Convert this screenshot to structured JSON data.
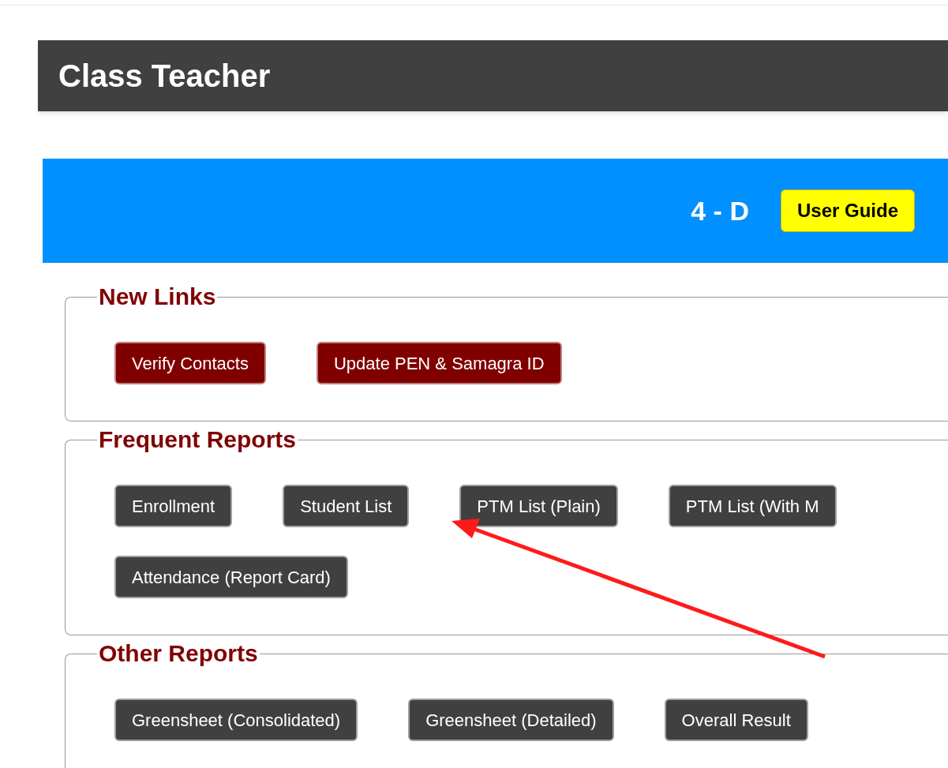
{
  "header": {
    "title": "Class Teacher"
  },
  "banner": {
    "class_label": "4 - D",
    "guide_button": "User Guide"
  },
  "sections": [
    {
      "legend": "New Links",
      "kind": "new",
      "rows": [
        [
          "Verify Contacts",
          "Update PEN & Samagra ID"
        ]
      ]
    },
    {
      "legend": "Frequent Reports",
      "kind": "report",
      "rows": [
        [
          "Enrollment",
          "Student List",
          "PTM List (Plain)",
          "PTM List (With M"
        ],
        [
          "Attendance (Report Card)"
        ]
      ]
    },
    {
      "legend": "Other Reports",
      "kind": "report",
      "rows": [
        [
          "Greensheet (Consolidated)",
          "Greensheet (Detailed)",
          "Overall Result"
        ]
      ]
    }
  ]
}
